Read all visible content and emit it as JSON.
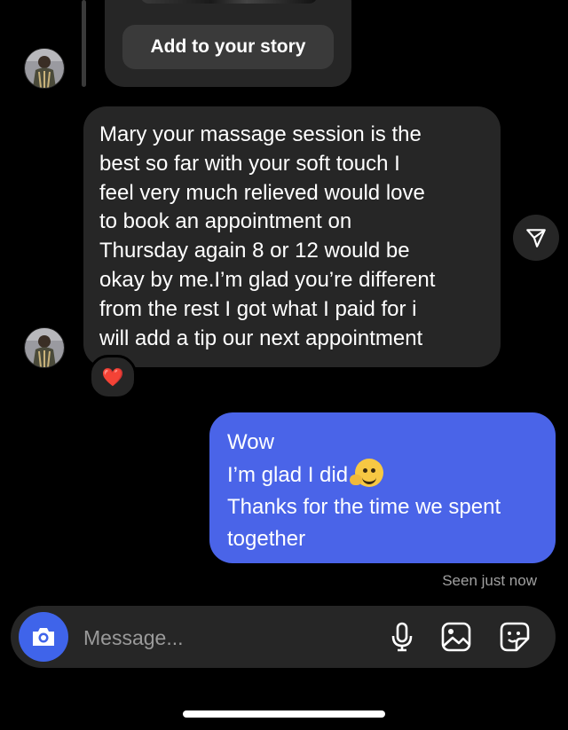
{
  "story": {
    "add_button_label": "Add to your story"
  },
  "incoming": {
    "text": "Mary your massage session is the\nbest so far with your soft touch I\nfeel very much relieved would love\nto book an appointment on\nThursday again 8 or 12 would be\nokay by me.I’m glad you’re different\nfrom the rest I got what I paid for i\nwill add a tip our next appointment",
    "reaction": "❤️"
  },
  "outgoing": {
    "lines": [
      "Wow",
      "I’m glad I did",
      "Thanks for the time we spent",
      "together"
    ]
  },
  "status": {
    "seen_text": "Seen just now"
  },
  "composer": {
    "placeholder": "Message...",
    "icons": [
      "camera-icon",
      "microphone-icon",
      "gallery-icon",
      "sticker-icon"
    ]
  },
  "colors": {
    "background": "#000000",
    "incoming_bubble": "#262626",
    "outgoing_bubble": "#4a64e8",
    "camera_button": "#3f64ea"
  }
}
